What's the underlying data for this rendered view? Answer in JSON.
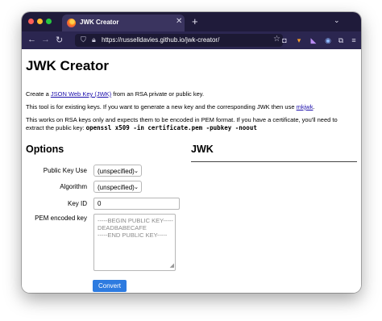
{
  "browser": {
    "tab_title": "JWK Creator",
    "tab_close": "✕",
    "new_tab": "+",
    "tab_list": "⌄",
    "nav": {
      "back": "←",
      "forward": "→",
      "reload": "↻"
    },
    "url": "https://russelldavies.github.io/jwk-creator/",
    "icons": [
      "shield-icon",
      "lock-icon",
      "star-icon",
      "pocket-icon",
      "extension-fox-icon",
      "extension-bird-icon",
      "account-icon",
      "extensions-icon",
      "menu-icon"
    ]
  },
  "page": {
    "title": "JWK Creator",
    "intro_prefix": "Create a ",
    "intro_link": "JSON Web Key (JWK)",
    "intro_suffix": " from an RSA private or public key.",
    "existing_prefix": "This tool is for existing keys. If you want to generate a new key and the corresponding JWK then use ",
    "existing_link": "mkjwk",
    "existing_suffix": ".",
    "pem_text": "This works on RSA keys only and expects them to be encoded in PEM format. If you have a certificate, you'll need to extract the public key: ",
    "pem_command": "openssl x509 -in certificate.pem -pubkey -noout",
    "options_heading": "Options",
    "jwk_heading": "JWK",
    "form": {
      "public_key_use_label": "Public Key Use",
      "public_key_use_value": "(unspecified)",
      "algorithm_label": "Algorithm",
      "algorithm_value": "(unspecified)",
      "key_id_label": "Key ID",
      "key_id_value": "0",
      "pem_label": "PEM encoded key",
      "pem_placeholder": "-----BEGIN PUBLIC KEY-----\nDEADBABECAFE\n-----END PUBLIC KEY-----",
      "convert_label": "Convert"
    }
  },
  "colors": {
    "tabbar": "#1f1b3a",
    "navbar": "#2b2650",
    "button": "#2d7be0",
    "link": "#1a0dab"
  }
}
